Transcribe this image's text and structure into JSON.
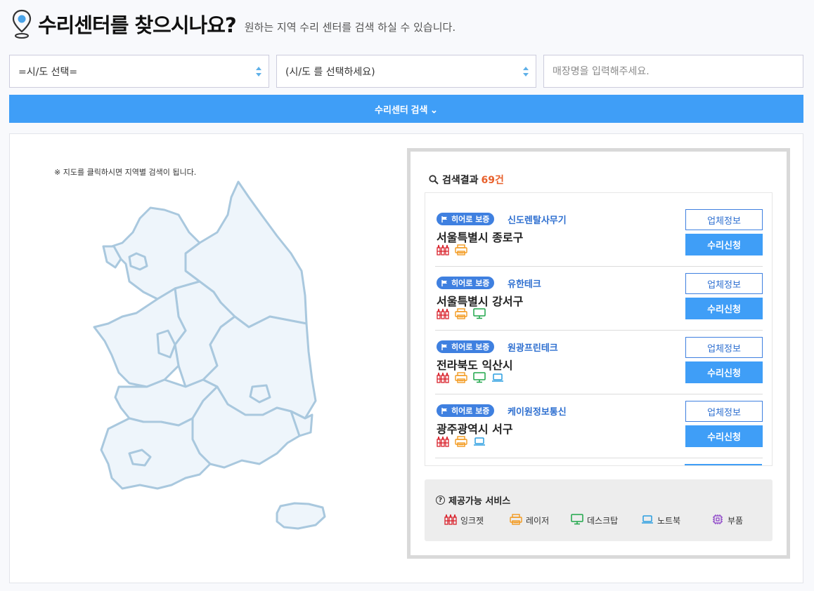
{
  "header": {
    "title": "수리센터를 찾으시나요?",
    "subtitle": "원하는 지역 수리 센터를 검색 하실 수 있습니다."
  },
  "filters": {
    "region_select": "=시/도 선택=",
    "district_select": "(시/도 를 선택하세요)",
    "store_placeholder": "매장명을 입력해주세요."
  },
  "search_button": "수리센터 검색 ⌄",
  "map": {
    "note": "※ 지도를 클릭하시면 지역별 검색이 됩니다."
  },
  "results": {
    "label": "검색결과",
    "count": "69건",
    "badge_label": "히어로 보증",
    "info_button": "업체정보",
    "request_button": "수리신청",
    "items": [
      {
        "name": "신도렌탈사무기",
        "address": "서울특별시 종로구",
        "services": [
          "inkjet-icon",
          "laser-icon"
        ]
      },
      {
        "name": "유한테크",
        "address": "서울특별시 강서구",
        "services": [
          "inkjet-icon",
          "laser-icon",
          "desktop-icon"
        ]
      },
      {
        "name": "원광프린테크",
        "address": "전라북도 익산시",
        "services": [
          "inkjet-icon",
          "laser-icon",
          "desktop-icon",
          "laptop-icon"
        ]
      },
      {
        "name": "케이원정보통신",
        "address": "광주광역시 서구",
        "services": [
          "inkjet-icon",
          "laser-icon",
          "laptop-icon"
        ]
      }
    ]
  },
  "legend": {
    "title": "제공가능 서비스",
    "items": [
      {
        "icon": "inkjet-icon",
        "label": "잉크젯"
      },
      {
        "icon": "laser-icon",
        "label": "레이저"
      },
      {
        "icon": "desktop-icon",
        "label": "데스크탑"
      },
      {
        "icon": "laptop-icon",
        "label": "노트북"
      },
      {
        "icon": "parts-icon",
        "label": "부품"
      }
    ]
  },
  "colors": {
    "primary": "#3f9ef7",
    "badge": "#3f80e0",
    "count": "#e8612c",
    "inkjet": "#d9232d",
    "laser": "#f39a1e",
    "desktop": "#1fa64a",
    "laptop": "#2a9de0",
    "parts": "#8a3fc7",
    "map_fill": "#eef5fb",
    "map_stroke": "#a9c8de"
  }
}
